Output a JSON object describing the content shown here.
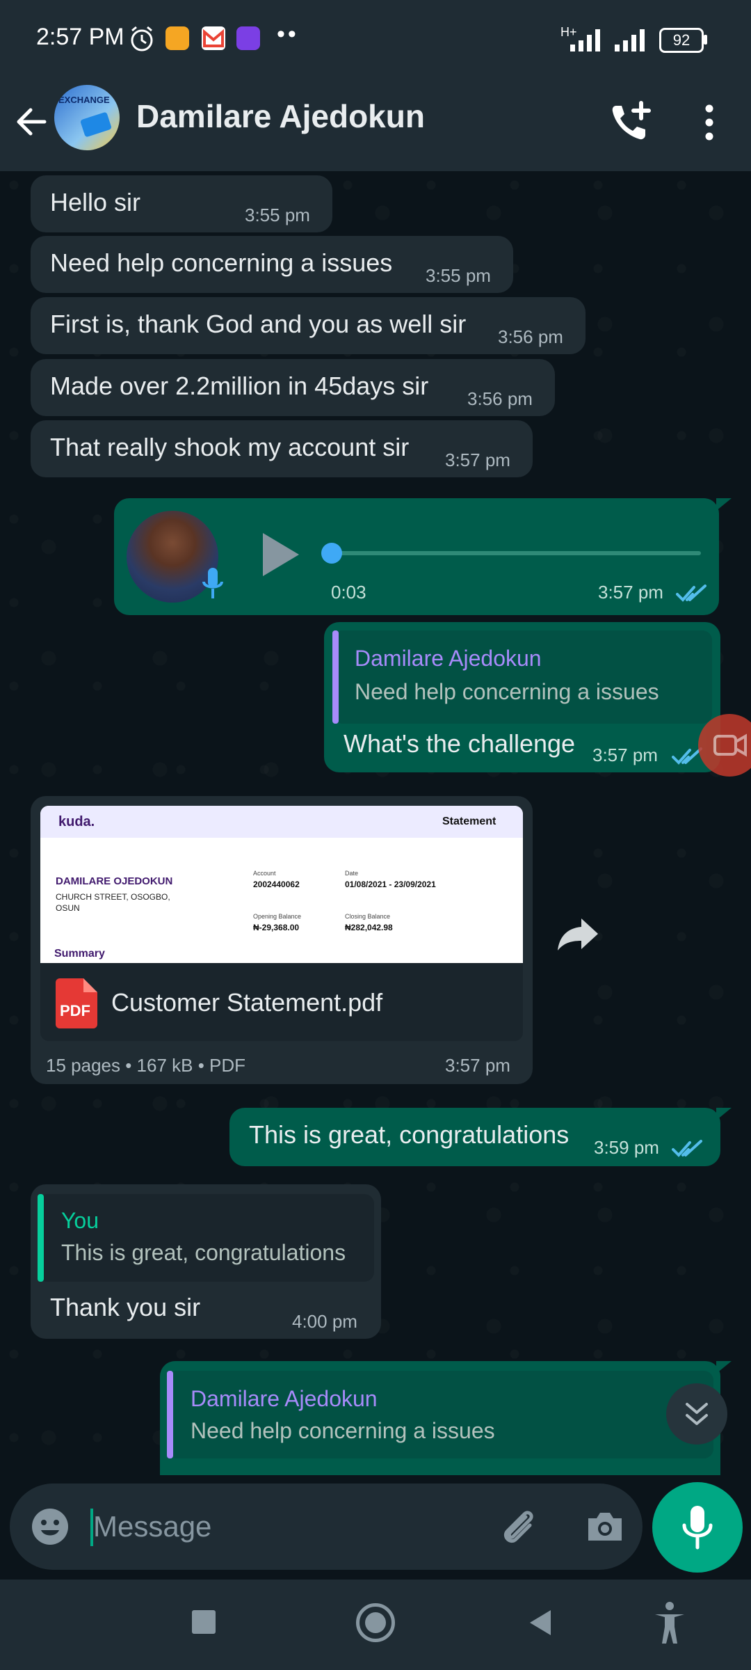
{
  "status_bar": {
    "time": "2:57 PM",
    "network": "H+",
    "battery": "92"
  },
  "header": {
    "contact_name": "Damilare Ajedokun",
    "avatar_text": "EXCHANGE"
  },
  "messages": {
    "m1": {
      "text": "Hello sir",
      "time": "3:55 pm"
    },
    "m2": {
      "text": "Need help concerning a issues",
      "time": "3:55 pm"
    },
    "m3": {
      "text": "First is, thank God and you as well sir",
      "time": "3:56 pm"
    },
    "m4": {
      "text": "Made over 2.2million in 45days sir",
      "time": "3:56 pm"
    },
    "m5": {
      "text": "That really shook my account sir",
      "time": "3:57 pm"
    },
    "voice": {
      "duration": "0:03",
      "time": "3:57 pm",
      "progress": 0.0
    },
    "reply1": {
      "quote_name": "Damilare Ajedokun",
      "quote_text": "Need help concerning a issues",
      "text": "What's the challenge",
      "time": "3:57 pm"
    },
    "doc": {
      "brand": "kuda.",
      "doc_title": "Statement",
      "name": "DAMILARE OJEDOKUN",
      "address1": "CHURCH STREET, OSOGBO,",
      "address2": "OSUN",
      "account_label": "Account",
      "account_value": "2002440062",
      "date_label": "Date",
      "date_value": "01/08/2021 - 23/09/2021",
      "opening_label": "Opening Balance",
      "opening_value": "₦-29,368.00",
      "closing_label": "Closing Balance",
      "closing_value": "₦282,042.98",
      "summary": "Summary",
      "pdf_badge": "PDF",
      "filename": "Customer Statement.pdf",
      "meta": "15 pages • 167 kB • PDF",
      "time": "3:57 pm"
    },
    "m6": {
      "text": "This is great, congratulations",
      "time": "3:59 pm"
    },
    "reply2": {
      "quote_name": "You",
      "quote_text": "This is great, congratulations",
      "text": "Thank you sir",
      "time": "4:00 pm"
    },
    "reply3": {
      "quote_name": "Damilare Ajedokun",
      "quote_text": "Need help concerning a issues"
    }
  },
  "composer": {
    "placeholder": "Message"
  },
  "colors": {
    "outgoing_bubble": "#005c4b",
    "incoming_bubble": "#202c33",
    "accent": "#00a884",
    "read_ticks": "#53bdeb",
    "quote_name_other": "#a78bfa",
    "quote_name_you": "#06cf9c"
  }
}
